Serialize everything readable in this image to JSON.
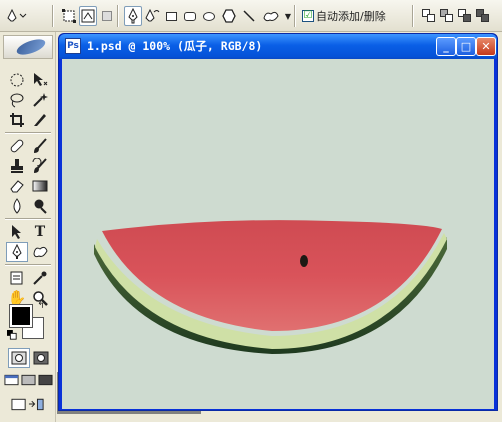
{
  "options_bar": {
    "tools": [
      {
        "icon": "pen-tool-icon"
      },
      {
        "icon": "shape-layers-icon"
      },
      {
        "icon": "paths-icon"
      },
      {
        "icon": "fill-pixels-icon"
      },
      {
        "icon": "pen-icon"
      },
      {
        "icon": "freeform-pen-icon"
      },
      {
        "icon": "rectangle-icon"
      },
      {
        "icon": "rounded-rectangle-icon"
      },
      {
        "icon": "ellipse-icon"
      },
      {
        "icon": "polygon-icon"
      },
      {
        "icon": "line-icon"
      },
      {
        "icon": "custom-shape-icon"
      }
    ],
    "auto_add_delete_label": "自动添加/删除",
    "auto_add_delete_checked": "☑"
  },
  "document": {
    "title": "1.psd @ 100% (瓜子, RGB/8)",
    "minimize": "_",
    "maximize": "□",
    "close": "✕",
    "canvas_color": "#cedbd0"
  },
  "toolbox": {
    "foreground_color": "#000000",
    "background_color": "#ffffff"
  }
}
